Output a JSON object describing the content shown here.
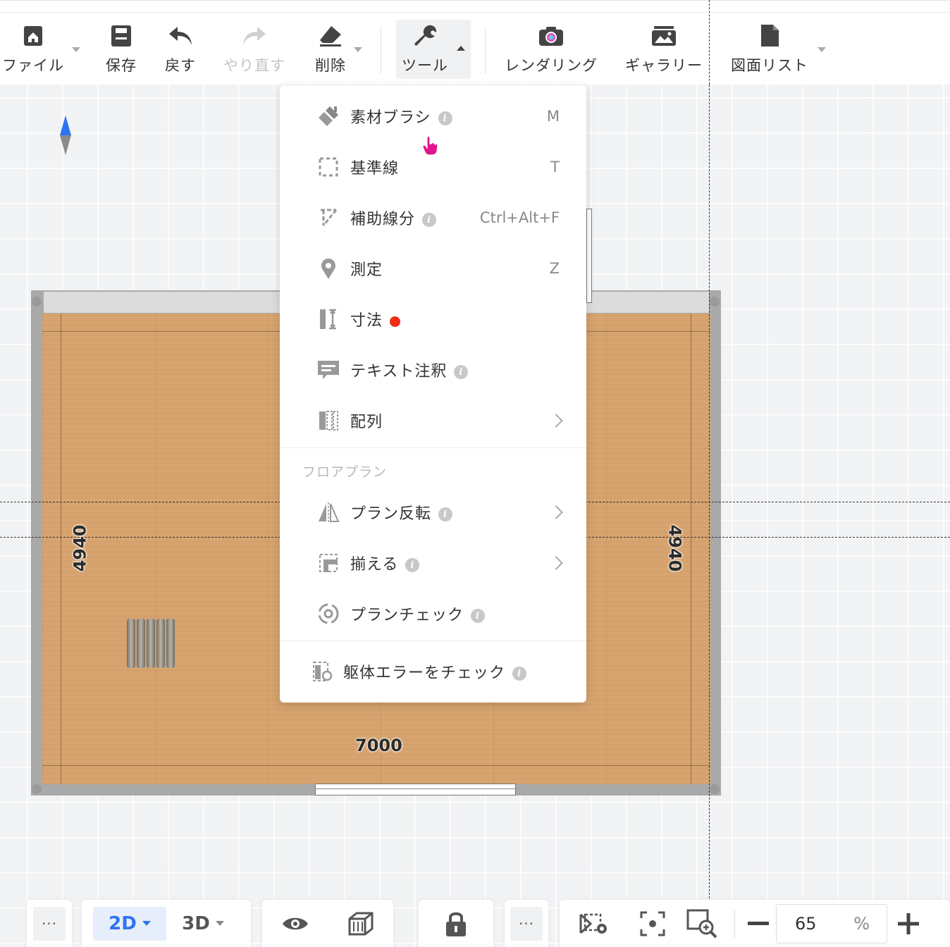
{
  "toolbar": {
    "file": "ファイル",
    "save": "保存",
    "undo": "戻す",
    "redo": "やり直す",
    "delete": "削除",
    "tools": "ツール",
    "rendering": "レンダリング",
    "gallery": "ギャラリー",
    "drawing_list": "図面リスト"
  },
  "menu": {
    "items": [
      {
        "label": "素材ブラシ",
        "shortcut": "M",
        "icon": "brush-icon"
      },
      {
        "label": "基準線",
        "shortcut": "T",
        "icon": "guide-line-icon"
      },
      {
        "label": "補助線分",
        "shortcut": "Ctrl+Alt+F",
        "icon": "auxiliary-line-icon"
      },
      {
        "label": "測定",
        "shortcut": "Z",
        "icon": "measure-icon"
      },
      {
        "label": "寸法",
        "shortcut": "",
        "icon": "dimension-icon"
      },
      {
        "label": "テキスト注釈",
        "shortcut": "",
        "icon": "text-note-icon"
      },
      {
        "label": "配列",
        "shortcut": "",
        "icon": "array-icon"
      }
    ],
    "section_floorplan": "フロアプラン",
    "floor_items": [
      {
        "label": "プラン反転",
        "icon": "flip-icon"
      },
      {
        "label": "揃える",
        "icon": "align-icon"
      },
      {
        "label": "プランチェック",
        "icon": "plan-check-icon"
      }
    ],
    "structure_check": "躯体エラーをチェック"
  },
  "plan": {
    "dim_left": "4940",
    "dim_right": "4940",
    "dim_bottom": "7000"
  },
  "bottom": {
    "more": "···",
    "view_2d": "2D",
    "view_3d": "3D",
    "zoom_value": "65",
    "zoom_unit": "%"
  },
  "colors": {
    "accent": "#2f73f0",
    "floor": "#d7a46f",
    "wall": "#a9a9a9",
    "badge_red": "#f02d18"
  }
}
